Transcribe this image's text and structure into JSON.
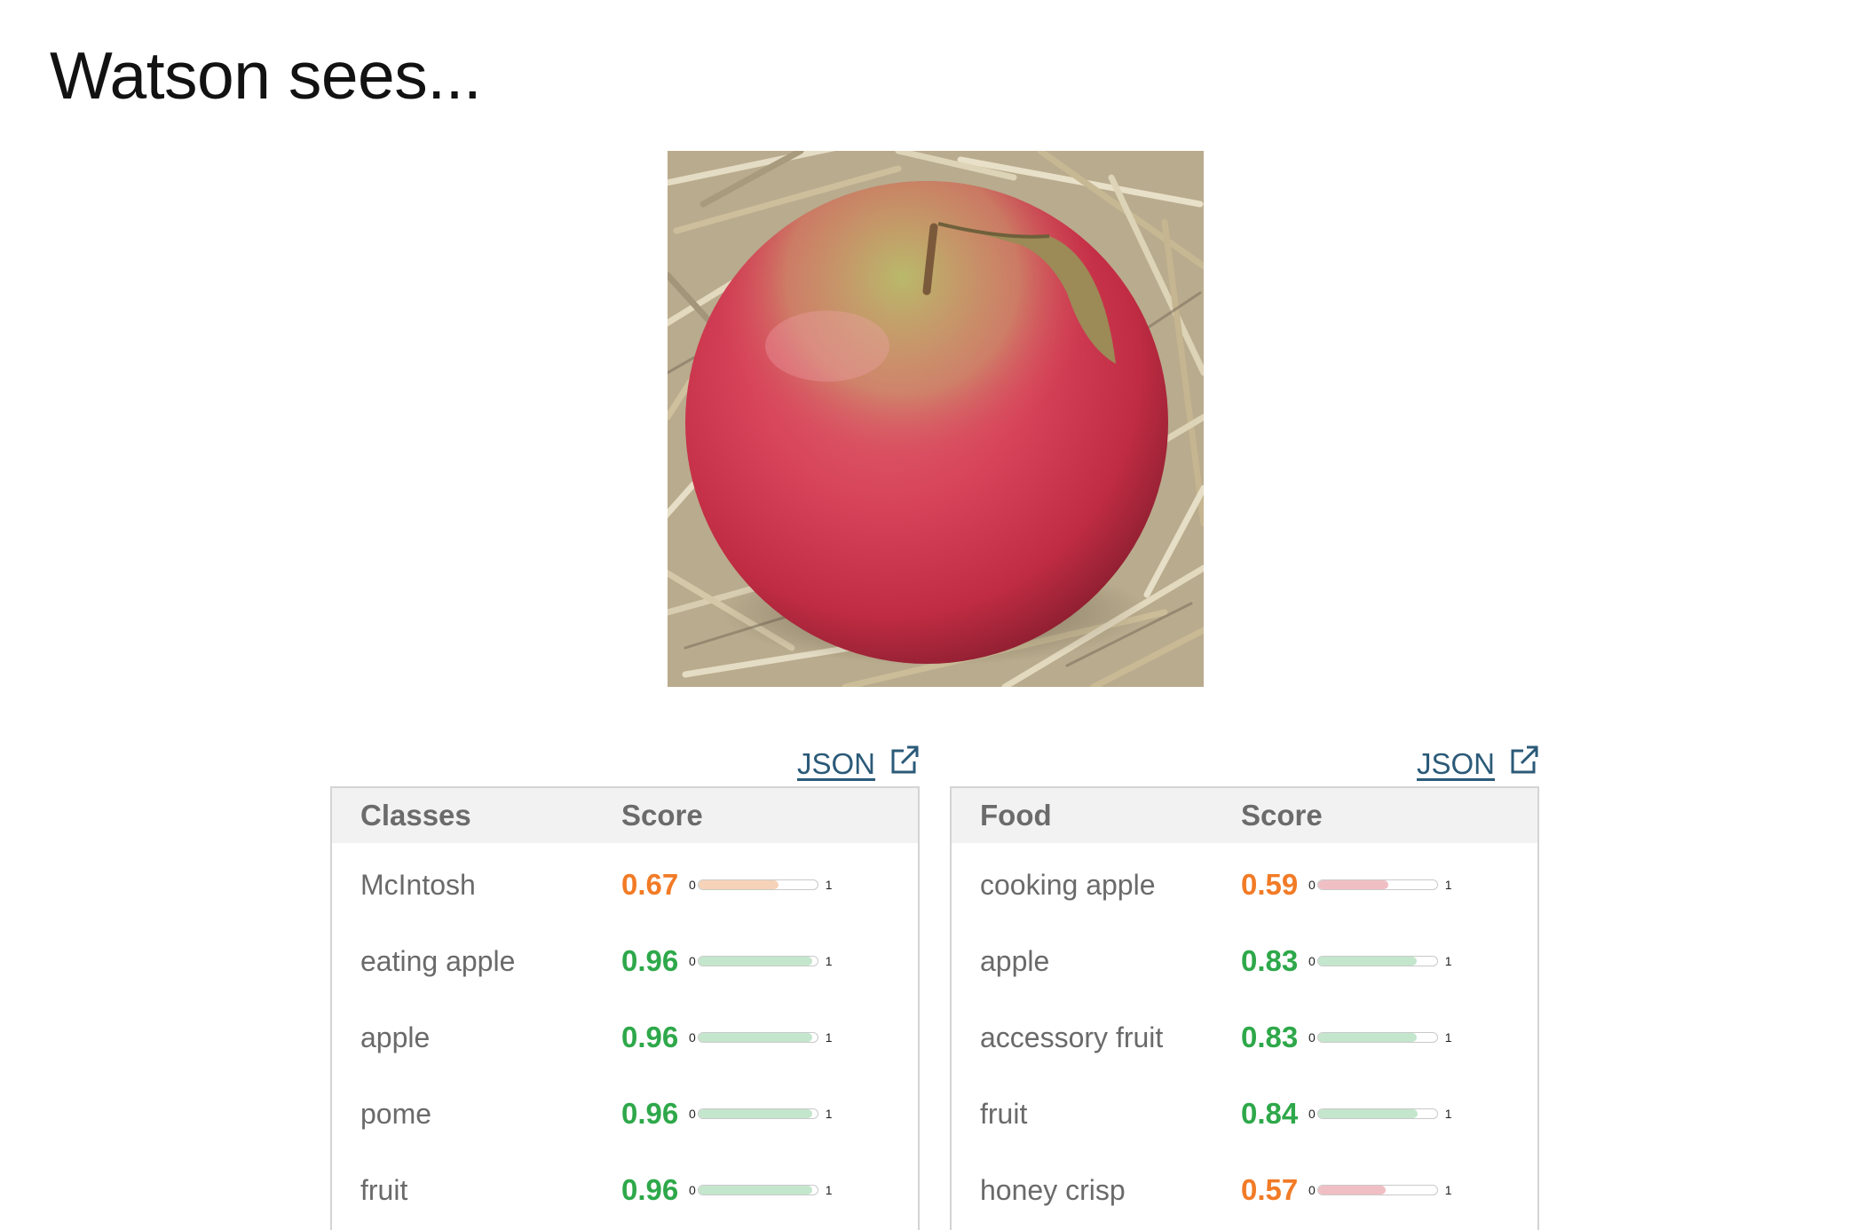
{
  "page_title": "Watson sees...",
  "image": {
    "subject": "red apple on straw"
  },
  "panels": [
    {
      "json_link_label": "JSON",
      "columns": {
        "name": "Classes",
        "score": "Score"
      },
      "bar_min_label": "0",
      "bar_max_label": "1",
      "rows": [
        {
          "name": "McIntosh",
          "score": "0.67",
          "fraction": 0.67,
          "level": "orange",
          "bar_color": "#f6d3b8"
        },
        {
          "name": "eating apple",
          "score": "0.96",
          "fraction": 0.96,
          "level": "green",
          "bar_color": "#c3e6cc"
        },
        {
          "name": "apple",
          "score": "0.96",
          "fraction": 0.96,
          "level": "green",
          "bar_color": "#c3e6cc"
        },
        {
          "name": "pome",
          "score": "0.96",
          "fraction": 0.96,
          "level": "green",
          "bar_color": "#c3e6cc"
        },
        {
          "name": "fruit",
          "score": "0.96",
          "fraction": 0.96,
          "level": "green",
          "bar_color": "#c3e6cc"
        }
      ]
    },
    {
      "json_link_label": "JSON",
      "columns": {
        "name": "Food",
        "score": "Score"
      },
      "bar_min_label": "0",
      "bar_max_label": "1",
      "rows": [
        {
          "name": "cooking apple",
          "score": "0.59",
          "fraction": 0.59,
          "level": "orange",
          "bar_color": "#f0bfc4"
        },
        {
          "name": "apple",
          "score": "0.83",
          "fraction": 0.83,
          "level": "green",
          "bar_color": "#c3e6cc"
        },
        {
          "name": "accessory fruit",
          "score": "0.83",
          "fraction": 0.83,
          "level": "green",
          "bar_color": "#c3e6cc"
        },
        {
          "name": "fruit",
          "score": "0.84",
          "fraction": 0.84,
          "level": "green",
          "bar_color": "#c3e6cc"
        },
        {
          "name": "honey crisp",
          "score": "0.57",
          "fraction": 0.57,
          "level": "orange",
          "bar_color": "#f0bfc4"
        }
      ]
    }
  ],
  "colors": {
    "orange": "#f27b26",
    "green": "#2ea84a",
    "link": "#2b5a78"
  }
}
